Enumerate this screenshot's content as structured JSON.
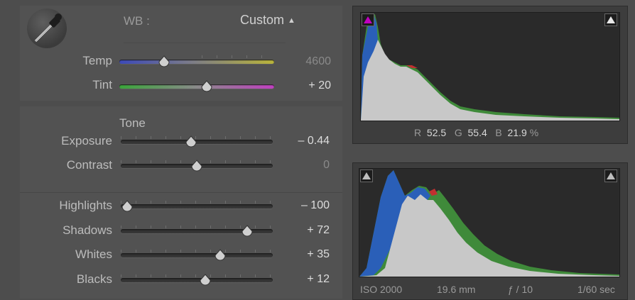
{
  "wb": {
    "label": "WB :",
    "preset": "Custom",
    "temp": {
      "label": "Temp",
      "value": "4600",
      "position": 0.3
    },
    "tint": {
      "label": "Tint",
      "value": "+ 20",
      "position": 0.57
    }
  },
  "tone": {
    "heading": "Tone",
    "sliders": [
      {
        "label": "Exposure",
        "value": "– 0.44",
        "position": 0.46
      },
      {
        "label": "Contrast",
        "value": "0",
        "position": 0.5
      },
      {
        "label": "Highlights",
        "value": "– 100",
        "position": 0.0
      },
      {
        "label": "Shadows",
        "value": "+ 72",
        "position": 0.86
      },
      {
        "label": "Whites",
        "value": "+ 35",
        "position": 0.67
      },
      {
        "label": "Blacks",
        "value": "+ 12",
        "position": 0.56
      }
    ]
  },
  "histogram_top": {
    "r_label": "R",
    "r_value": "52.5",
    "g_label": "G",
    "g_value": "55.4",
    "b_label": "B",
    "b_value": "21.9",
    "unit": "%"
  },
  "histogram_bottom": {
    "iso": "ISO 2000",
    "focal": "19.6 mm",
    "aperture": "ƒ / 10",
    "shutter": "1/60 sec"
  },
  "colors": {
    "shadow_clip_on": "#c000c0",
    "highlight_clip_on": "#e8e8e8",
    "histo_blue": "#2a5fb8",
    "histo_green": "#3f8a3a",
    "histo_red": "#c03030",
    "histo_gray": "#c8c8c8"
  }
}
